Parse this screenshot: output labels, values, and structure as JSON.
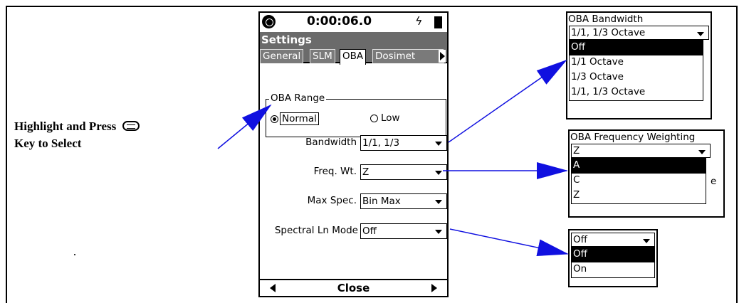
{
  "caption": {
    "line1": "Highlight and Press",
    "line2": "Key to Select",
    "enter_key_icon": "enter-key-icon"
  },
  "device": {
    "status": {
      "time": "0:00:06.0",
      "power_glyph": "ϟ"
    },
    "title": "Settings",
    "tabs": [
      "General",
      "SLM",
      "OBA",
      "Dosimet"
    ],
    "active_tab": "OBA",
    "oba_range": {
      "title": "OBA Range",
      "options": [
        "Normal",
        "Low"
      ],
      "selected": "Normal"
    },
    "fields": {
      "bandwidth": {
        "label": "Bandwidth",
        "value": "1/1, 1/3"
      },
      "freq_wt": {
        "label": "Freq. Wt.",
        "value": "Z"
      },
      "max_spec": {
        "label": "Max Spec.",
        "value": "Bin Max"
      },
      "spectral_ln": {
        "label": "Spectral Ln Mode",
        "value": "Off"
      }
    },
    "bottom": {
      "close": "Close"
    }
  },
  "popups": {
    "bandwidth": {
      "title": "OBA Bandwidth",
      "current": "1/1, 1/3 Octave",
      "options": [
        "Off",
        "1/1 Octave",
        "1/3 Octave",
        "1/1, 1/3 Octave"
      ],
      "highlighted": "Off"
    },
    "freq_weighting": {
      "title": "OBA Frequency Weighting",
      "current": "Z",
      "options": [
        "A",
        "C",
        "Z"
      ],
      "highlighted": "A",
      "peek": "e"
    },
    "spectral_ln": {
      "current": "Off",
      "options": [
        "Off",
        "On"
      ],
      "highlighted": "Off"
    }
  },
  "colors": {
    "arrow": "#1010e0",
    "title_bar": "#6b6b6b"
  }
}
